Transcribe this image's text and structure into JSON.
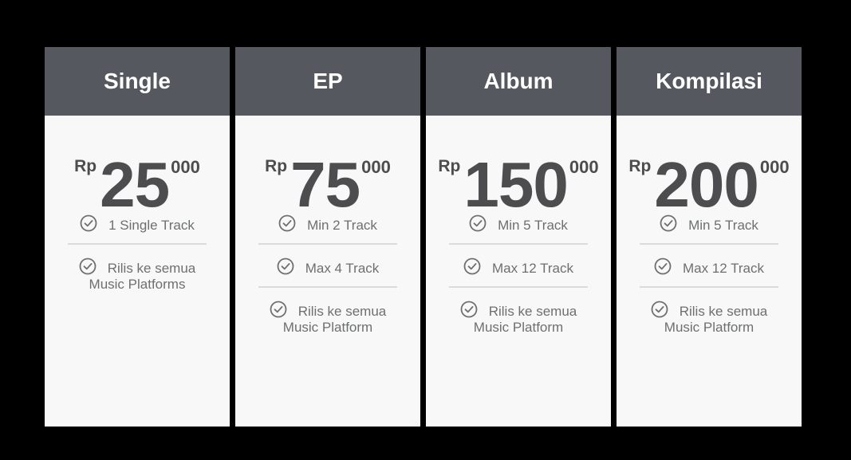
{
  "plans": [
    {
      "name": "Single",
      "currency": "Rp",
      "amount": "25",
      "suffix": "000",
      "features": [
        "1 Single Track",
        "Rilis ke semua\nMusic Platforms"
      ]
    },
    {
      "name": "EP",
      "currency": "Rp",
      "amount": "75",
      "suffix": "000",
      "features": [
        "Min 2 Track",
        "Max 4 Track",
        "Rilis ke semua\nMusic Platform"
      ]
    },
    {
      "name": "Album",
      "currency": "Rp",
      "amount": "150",
      "suffix": "000",
      "features": [
        "Min 5 Track",
        "Max 12 Track",
        "Rilis ke semua\nMusic Platform"
      ]
    },
    {
      "name": "Kompilasi",
      "currency": "Rp",
      "amount": "200",
      "suffix": "000",
      "features": [
        "Min 5 Track",
        "Max 12 Track",
        "Rilis ke semua\nMusic Platform"
      ]
    }
  ],
  "icons": {
    "feature_icon": "check-circle-icon"
  },
  "colors": {
    "page_background": "#000000",
    "header_background": "#55595f",
    "card_background": "#f7f8f7",
    "price_text": "#4d4d4f",
    "feature_text": "#6e6f71"
  }
}
